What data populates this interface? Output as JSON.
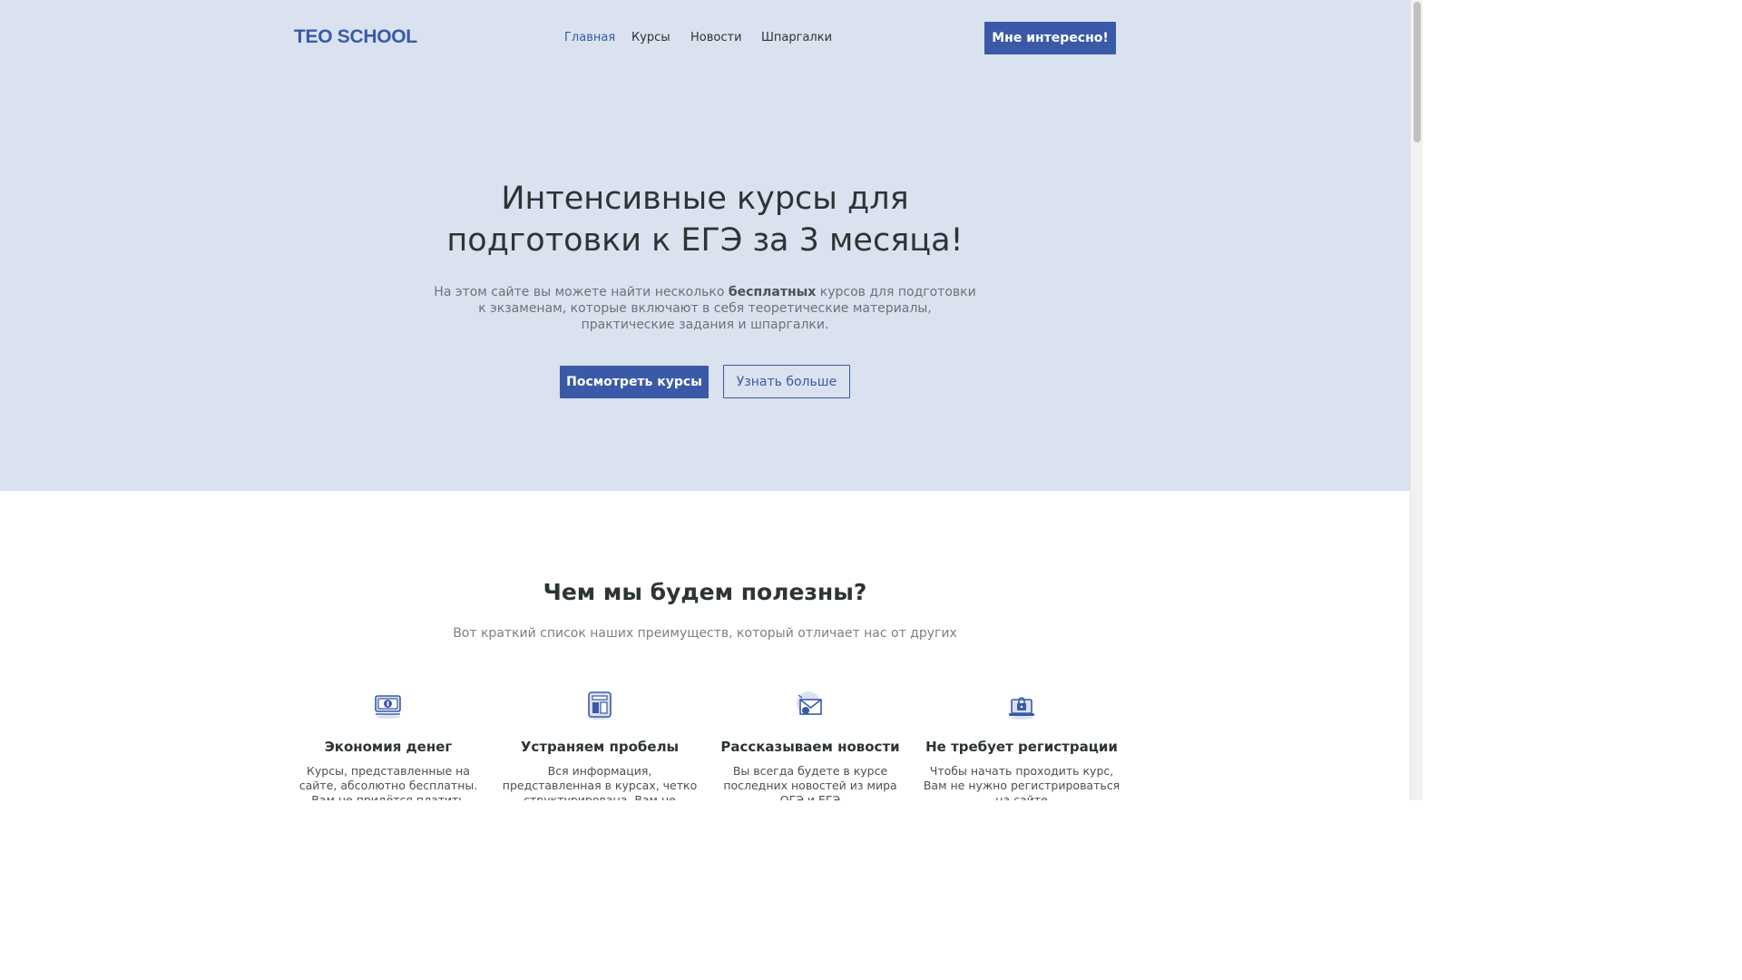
{
  "header": {
    "logo": "TEO SCHOOL",
    "nav": [
      {
        "label": "Главная",
        "active": true
      },
      {
        "label": "Курсы",
        "active": false
      },
      {
        "label": "Новости",
        "active": false
      },
      {
        "label": "Шпаргалки",
        "active": false
      }
    ],
    "cta_label": "Мне интересно!"
  },
  "hero": {
    "title_line1": "Интенсивные курсы для",
    "title_line2": "подготовки к ЕГЭ за 3 месяца!",
    "text_before": "На этом сайте вы можете найти несколько ",
    "text_bold": "бесплатных",
    "text_after": " курсов для подготовки к экзаменам, которые включают в себя теоретические материалы, практические задания и шпаргалки.",
    "primary_button": "Посмотреть курсы",
    "secondary_button": "Узнать больше"
  },
  "benefits": {
    "title": "Чем мы будем полезны?",
    "subtitle": "Вот краткий список наших преимуществ, который отличает нас от других",
    "items": [
      {
        "icon": "money-icon",
        "title": "Экономия денег",
        "text": "Курсы, представленные на сайте, абсолютно бесплатны. Вам не придётся платить"
      },
      {
        "icon": "book-icon",
        "title": "Устраняем пробелы",
        "text": "Вся информация, представленная в курсах, четко структурирована. Вам не"
      },
      {
        "icon": "mail-icon",
        "title": "Рассказываем новости",
        "text": "Вы всегда будете в курсе последних новостей из мира ОГЭ и ЕГЭ"
      },
      {
        "icon": "lock-laptop-icon",
        "title": "Не требует регистрации",
        "text": "Чтобы начать проходить курс, Вам не нужно регистрироваться на сайте"
      }
    ]
  },
  "colors": {
    "accent": "#3a5aa8",
    "hero_bg": "#dae1ef",
    "text_dark": "#2d3436",
    "text_muted": "#6c7378"
  }
}
